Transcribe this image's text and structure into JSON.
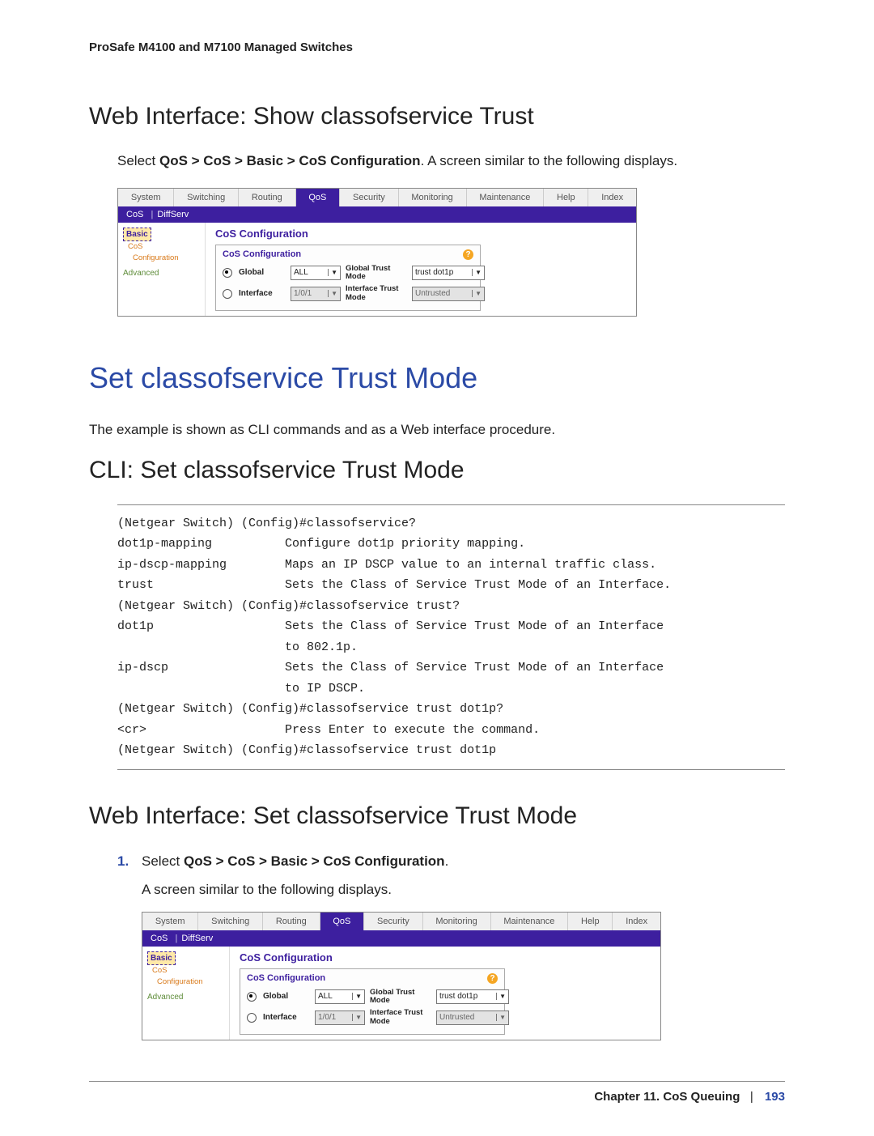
{
  "header": {
    "running": "ProSafe M4100 and M7100 Managed Switches"
  },
  "section1": {
    "heading": "Web Interface: Show classofservice Trust",
    "para_prefix": "Select ",
    "para_bold": "QoS > CoS > Basic > CoS Configuration",
    "para_suffix": ". A screen similar to the following displays."
  },
  "ui": {
    "tabs": [
      "System",
      "Switching",
      "Routing",
      "QoS",
      "Security",
      "Monitoring",
      "Maintenance",
      "Help",
      "Index"
    ],
    "active_tab": "QoS",
    "subbar_left": "CoS",
    "subbar_sep": "|",
    "subbar_right": "DiffServ",
    "sidebar": {
      "item_basic": "Basic",
      "item_cos": "CoS",
      "item_conf": "Configuration",
      "item_adv": "Advanced"
    },
    "content_title": "CoS Configuration",
    "panel_title": "CoS Configuration",
    "row1_label": "Global",
    "row1_select": "ALL",
    "row1_col": "Global Trust Mode",
    "row1_value": "trust dot1p",
    "row2_label": "Interface",
    "row2_select": "1/0/1",
    "row2_col": "Interface Trust Mode",
    "row2_value": "Untrusted"
  },
  "main_heading": "Set classofservice Trust Mode",
  "main_intro": "The example is shown as CLI commands and as a Web interface procedure.",
  "section_cli": {
    "heading": "CLI: Set classofservice Trust Mode",
    "code": "(Netgear Switch) (Config)#classofservice?\ndot1p-mapping          Configure dot1p priority mapping.\nip-dscp-mapping        Maps an IP DSCP value to an internal traffic class.\ntrust                  Sets the Class of Service Trust Mode of an Interface.\n(Netgear Switch) (Config)#classofservice trust?\ndot1p                  Sets the Class of Service Trust Mode of an Interface\n                       to 802.1p.\nip-dscp                Sets the Class of Service Trust Mode of an Interface\n                       to IP DSCP.\n(Netgear Switch) (Config)#classofservice trust dot1p?\n<cr>                   Press Enter to execute the command.\n(Netgear Switch) (Config)#classofservice trust dot1p"
  },
  "section_web2": {
    "heading": "Web Interface: Set classofservice Trust Mode",
    "step1a": "Select ",
    "step1b": "QoS > CoS > Basic > CoS Configuration",
    "step1c": ".",
    "step_sub": "A screen similar to the following displays."
  },
  "footer": {
    "chapter": "Chapter 11.  CoS Queuing",
    "sep": "|",
    "page": "193"
  }
}
